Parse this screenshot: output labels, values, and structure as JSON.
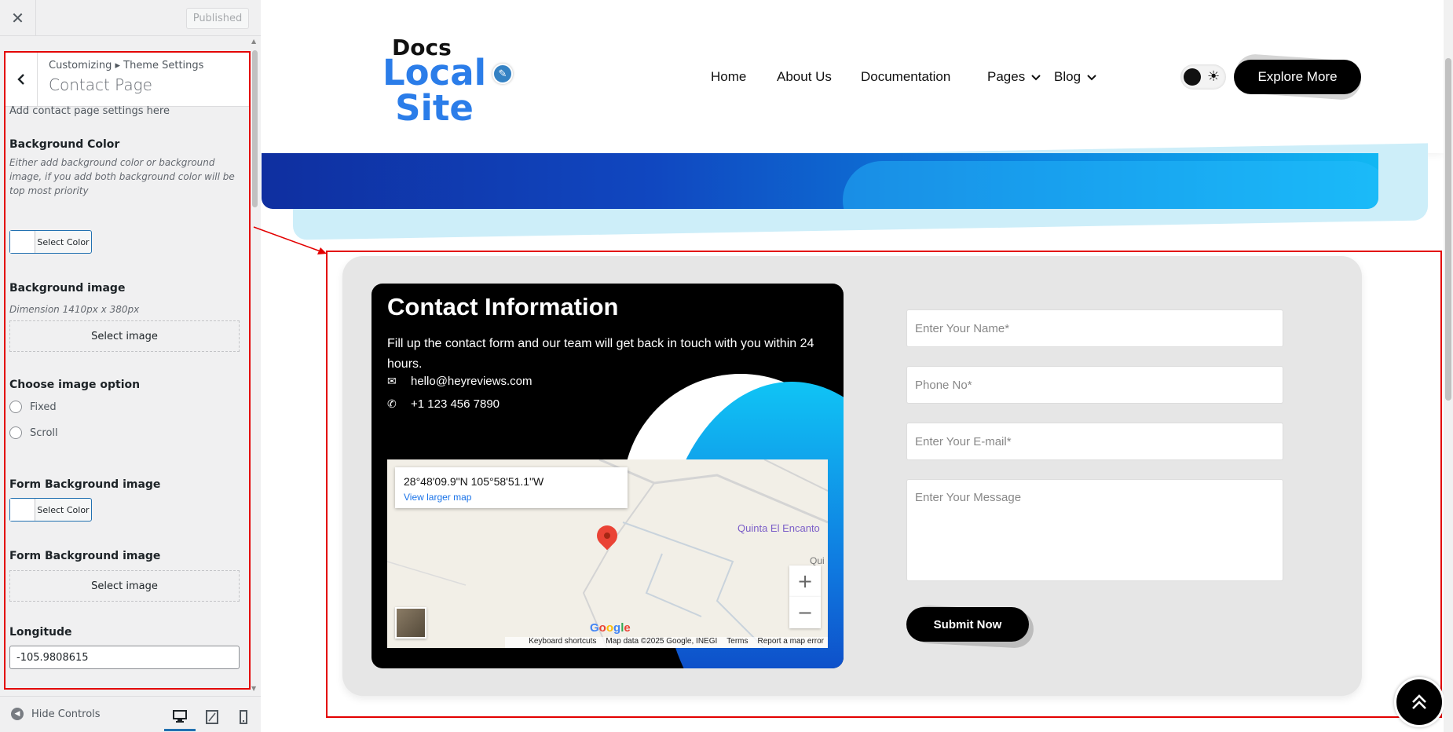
{
  "customizer": {
    "close_label": "✕",
    "published_label": "Published",
    "back_label": "‹",
    "breadcrumb": "Customizing ▸ Theme Settings",
    "section_title": "Contact Page",
    "intro": "Add contact page settings here",
    "bg_color": {
      "label": "Background Color",
      "description": "Either add background color or background image, if you add both background color will be top most priority",
      "button": "Select Color"
    },
    "bg_image": {
      "label": "Background image",
      "description": "Dimension 1410px x 380px",
      "button": "Select image"
    },
    "image_option": {
      "label": "Choose image option",
      "options": [
        "Fixed",
        "Scroll"
      ]
    },
    "form_bg_color": {
      "label": "Form Background image",
      "button": "Select Color"
    },
    "form_bg_image": {
      "label": "Form Background image",
      "button": "Select image"
    },
    "longitude": {
      "label": "Longitude",
      "value": "-105.9808615"
    },
    "footer": {
      "hide_controls": "Hide Controls"
    }
  },
  "site": {
    "logo": {
      "line1": "Docs",
      "line2": "Local",
      "line3": "Site"
    },
    "nav": [
      "Home",
      "About Us",
      "Documentation",
      "Pages",
      "Blog"
    ],
    "explore_button": "Explore More",
    "accent_color": "#2b7de9"
  },
  "contact": {
    "title": "Contact Information",
    "text": "Fill up the contact form and our team will get back in touch with you within 24 hours.",
    "email": "hello@heyreviews.com",
    "phone": "+1 123 456 7890",
    "map": {
      "coords": "28°48'09.9\"N 105°58'51.1\"W",
      "link": "View larger map",
      "place1": "Quinta El Encanto",
      "place2": "Qui",
      "attribution": [
        "Keyboard shortcuts",
        "Map data ©2025 Google, INEGI",
        "Terms",
        "Report a map error"
      ]
    },
    "form": {
      "name_placeholder": "Enter Your Name*",
      "phone_placeholder": "Phone No*",
      "email_placeholder": "Enter Your E-mail*",
      "message_placeholder": "Enter Your Message",
      "submit": "Submit Now"
    }
  }
}
